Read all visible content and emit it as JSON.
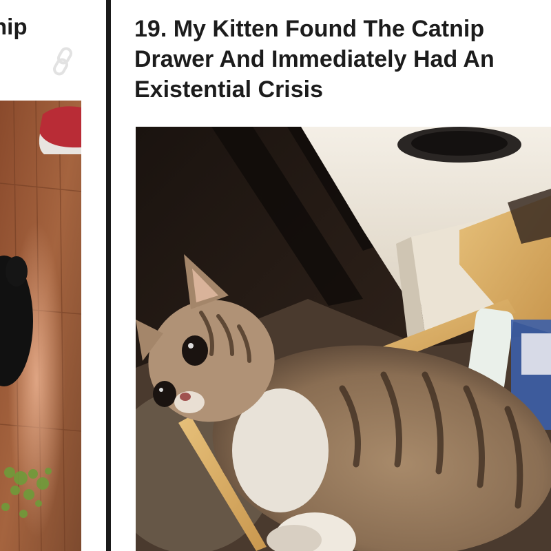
{
  "left_card": {
    "title_fragment": "nip",
    "link_icon": "link-icon",
    "photo": "kitten-on-wood-floor-with-catnip"
  },
  "right_card": {
    "title_lines": [
      "19. My Kitten Found The Catnip",
      "Drawer And Immediately Had An",
      "Existential Crisis"
    ],
    "photo": "tabby-kitten-lying-in-drawer"
  },
  "colors": {
    "background": "#ffffff",
    "title_text": "#1c1c1c",
    "divider": "#1a1a1a"
  }
}
